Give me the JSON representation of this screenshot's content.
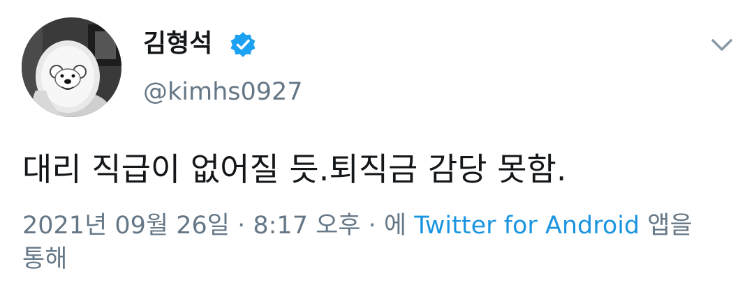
{
  "user": {
    "display_name": "김형석",
    "handle": "@kimhs0927",
    "verified": true,
    "avatar_description": "avatar-photo"
  },
  "tweet": {
    "text": "대리 직급이 없어질 듯.퇴직금 감당 못함.",
    "timestamp": "2021년 09월 26일 · 8:17 오후 · 에 ",
    "source_link": "Twitter for Android",
    "source_suffix": " 앱을 통해"
  },
  "icons": {
    "verified": "verified-badge-icon",
    "menu": "chevron-down-icon"
  },
  "colors": {
    "text": "#14171a",
    "secondary": "#657786",
    "link": "#1b95e0",
    "verified": "#1da1f2"
  }
}
